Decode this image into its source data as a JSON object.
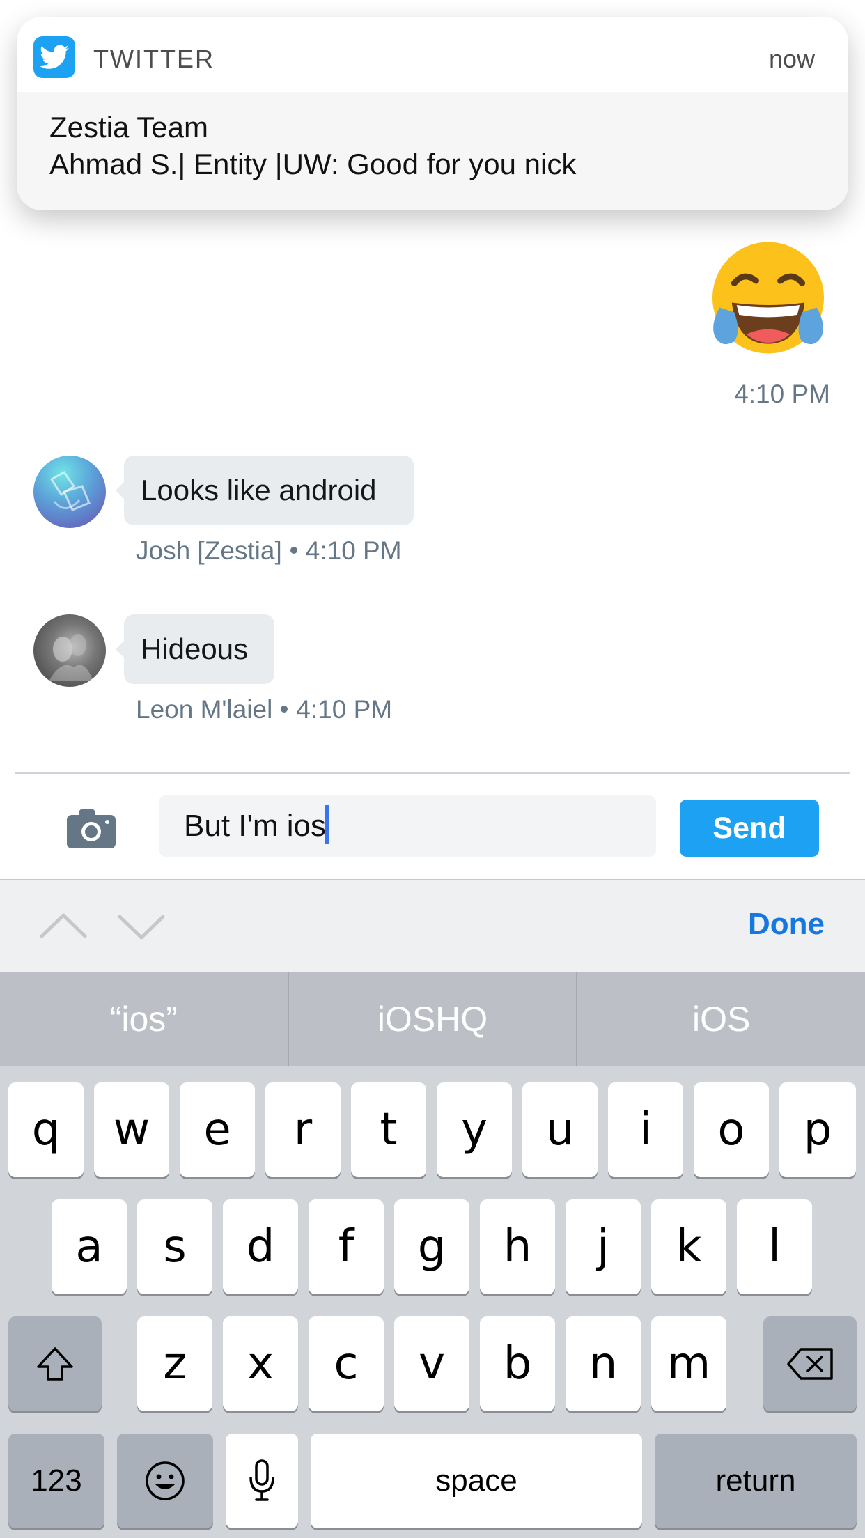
{
  "notification": {
    "app_icon": "twitter-bird-icon",
    "app_name": "TWITTER",
    "time": "now",
    "title": "Zestia Team",
    "message": "Ahmad S.| Entity |UW: Good for you nick"
  },
  "chat": {
    "emoji_message": {
      "emoji": "face-with-tears-of-joy",
      "time": "4:10 PM"
    },
    "messages": [
      {
        "author": "Josh [Zestia]",
        "text": "Looks like android",
        "time": "4:10 PM"
      },
      {
        "author": "Leon M'laiel",
        "text": "Hideous",
        "time": "4:10 PM"
      }
    ]
  },
  "composer": {
    "camera_icon": "camera-icon",
    "input_value": "But I'm ios",
    "send_label": "Send"
  },
  "accessory_bar": {
    "done_label": "Done"
  },
  "keyboard": {
    "suggestions": [
      "“ios”",
      "iOSHQ",
      "iOS"
    ],
    "row1": [
      "q",
      "w",
      "e",
      "r",
      "t",
      "y",
      "u",
      "i",
      "o",
      "p"
    ],
    "row2": [
      "a",
      "s",
      "d",
      "f",
      "g",
      "h",
      "j",
      "k",
      "l"
    ],
    "row3": [
      "z",
      "x",
      "c",
      "v",
      "b",
      "n",
      "m"
    ],
    "numbers_label": "123",
    "space_label": "space",
    "return_label": "return"
  },
  "colors": {
    "twitter_blue": "#1da1f2",
    "done_blue": "#1777e0",
    "bubble_gray": "#e8ecef",
    "meta_gray": "#657786"
  }
}
